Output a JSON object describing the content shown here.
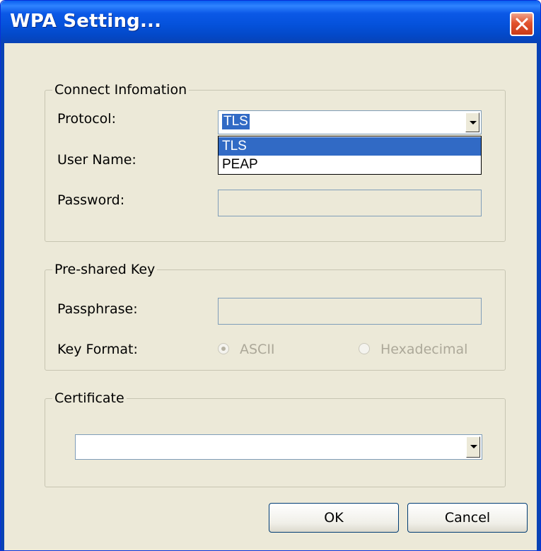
{
  "window": {
    "title": "WPA Setting..."
  },
  "connect": {
    "group_label": "Connect Infomation",
    "protocol_label": "Protocol:",
    "protocol_value": "TLS",
    "protocol_options": [
      "TLS",
      "PEAP"
    ],
    "username_label": "User Name:",
    "password_label": "Password:"
  },
  "psk": {
    "group_label": "Pre-shared Key",
    "passphrase_label": "Passphrase:",
    "key_format_label": "Key Format:",
    "ascii_label": "ASCII",
    "hex_label": "Hexadecimal",
    "selected": "ASCII"
  },
  "certificate": {
    "group_label": "Certificate",
    "value": ""
  },
  "buttons": {
    "ok": "OK",
    "cancel": "Cancel"
  },
  "icons": {
    "close": "close-icon",
    "dropdown": "chevron-down-icon"
  },
  "colors": {
    "title_bar": "#0552dc",
    "selection": "#316ac5",
    "dialog_bg": "#ece9d8",
    "close_button": "#e2532d"
  }
}
